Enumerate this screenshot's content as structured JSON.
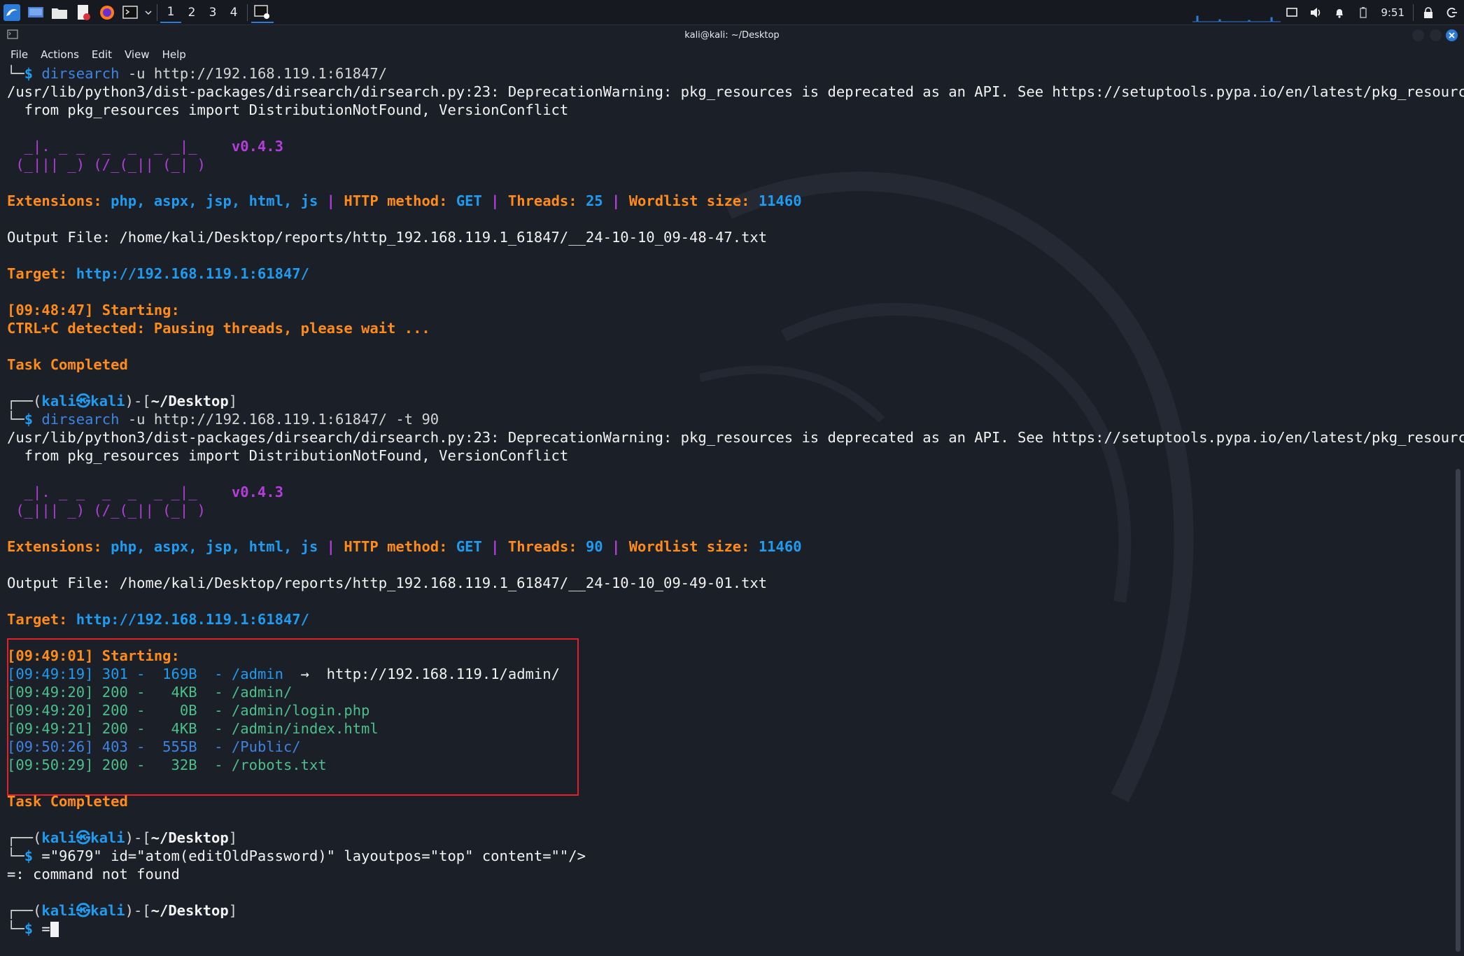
{
  "panel": {
    "workspaces": [
      "1",
      "2",
      "3",
      "4"
    ],
    "clock": "9:51"
  },
  "window": {
    "title": "kali@kali: ~/Desktop"
  },
  "menu": [
    "File",
    "Actions",
    "Edit",
    "View",
    "Help"
  ],
  "terminal": {
    "cmd1": "dirsearch -u http://192.168.119.1:61847/",
    "warn": "/usr/lib/python3/dist-packages/dirsearch/dirsearch.py:23: DeprecationWarning: pkg_resources is deprecated as an API. See https://setuptools.pypa.io/en/latest/pkg_resources",
    "warn2": "  from pkg_resources import DistributionNotFound, VersionConflict",
    "logo1": "  _|. _ _  _  _  _ _|_",
    "logo2": " (_||| _) (/_(_|| (_| )",
    "version": "v0.4.3",
    "ext_label": "Extensions: ",
    "ext_values": "php, aspx, jsp, html, js",
    "method_label": "HTTP method: ",
    "method_value": "GET",
    "threads_label": "Threads: ",
    "threads_1": "25",
    "threads_2": "90",
    "wordlist_label": "Wordlist size: ",
    "wordlist_value": "11460",
    "sep": " | ",
    "output1": "Output File: /home/kali/Desktop/reports/http_192.168.119.1_61847/__24-10-10_09-48-47.txt",
    "output2": "Output File: /home/kali/Desktop/reports/http_192.168.119.1_61847/__24-10-10_09-49-01.txt",
    "target_label": "Target: ",
    "target_url": "http://192.168.119.1:61847/",
    "start1": "[09:48:47] Starting: ",
    "ctrlc": "CTRL+C detected: Pausing threads, please wait ...",
    "task_completed": "Task Completed",
    "prompt_user": "kali",
    "prompt_sym": "㉿",
    "prompt_host": "kali",
    "prompt_dir": "~/Desktop",
    "cmd2": "dirsearch -u http://192.168.119.1:61847/ -t 90",
    "start2": "[09:49:01] Starting: ",
    "results": [
      {
        "ts": "[09:49:19] ",
        "code": "301",
        "size": "  169B",
        "path": " /admin",
        "extra": "  →  http://192.168.119.1/admin/"
      },
      {
        "ts": "[09:49:20] ",
        "code": "200",
        "size": "   4KB",
        "path": " /admin/",
        "extra": ""
      },
      {
        "ts": "[09:49:20] ",
        "code": "200",
        "size": "    0B",
        "path": " /admin/login.php",
        "extra": ""
      },
      {
        "ts": "[09:49:21] ",
        "code": "200",
        "size": "   4KB",
        "path": " /admin/index.html",
        "extra": ""
      },
      {
        "ts": "[09:50:26] ",
        "code": "403",
        "size": "  555B",
        "path": " /Public/",
        "extra": ""
      },
      {
        "ts": "[09:50:29] ",
        "code": "200",
        "size": "   32B",
        "path": " /robots.txt",
        "extra": ""
      }
    ],
    "cmd3": "=\"9679\" id=\"atom(editOldPassword)\" layoutpos=\"top\" content=\"\"/>",
    "error": "=: command not found",
    "cmd4": "="
  }
}
